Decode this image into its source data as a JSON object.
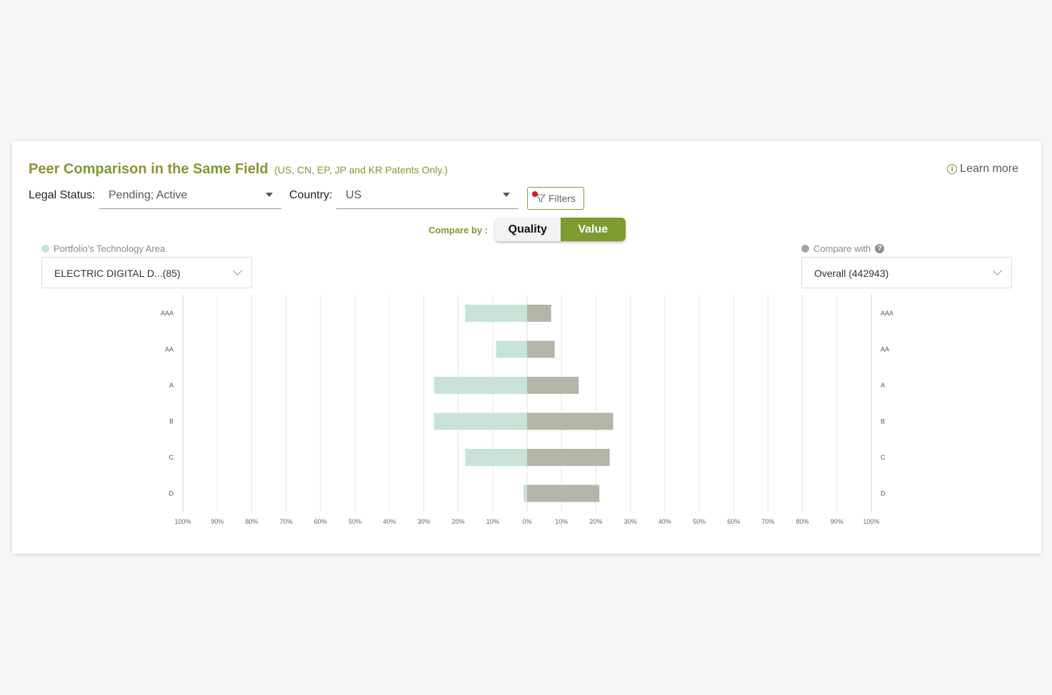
{
  "header": {
    "title": "Peer Comparison in the Same Field",
    "subtitle": "(US, CN, EP, JP and KR Patents Only.)",
    "learn_more": "Learn more"
  },
  "filters": {
    "legal_status_label": "Legal Status:",
    "legal_status_value": "Pending; Active",
    "country_label": "Country:",
    "country_value": "US",
    "filters_button": "Filters"
  },
  "compare": {
    "label": "Compare by :",
    "options": [
      "Quality",
      "Value"
    ],
    "selected": "Value"
  },
  "left_panel": {
    "label": "Portfolio's Technology Area",
    "select_value": "ELECTRIC DIGITAL D...(85)"
  },
  "right_panel": {
    "label": "Compare with",
    "select_value": "Overall (442943)"
  },
  "colors": {
    "accent": "#7f9a2f",
    "portfolio": "#c9e2d8",
    "compare": "#b5b5a7"
  },
  "chart_data": {
    "type": "bar",
    "orientation": "horizontal-diverging",
    "categories": [
      "AAA",
      "AA",
      "A",
      "B",
      "C",
      "D"
    ],
    "series": [
      {
        "name": "Portfolio's Technology Area",
        "side": "left",
        "values": [
          18,
          9,
          27,
          27,
          18,
          1
        ]
      },
      {
        "name": "Compare with",
        "side": "right",
        "values": [
          7,
          8,
          15,
          25,
          24,
          21
        ]
      }
    ],
    "x_ticks": [
      "100%",
      "90%",
      "80%",
      "70%",
      "60%",
      "50%",
      "40%",
      "30%",
      "20%",
      "10%",
      "0%",
      "10%",
      "20%",
      "30%",
      "40%",
      "50%",
      "60%",
      "70%",
      "80%",
      "90%",
      "100%"
    ],
    "xlim": [
      -100,
      100
    ],
    "grid": true
  }
}
